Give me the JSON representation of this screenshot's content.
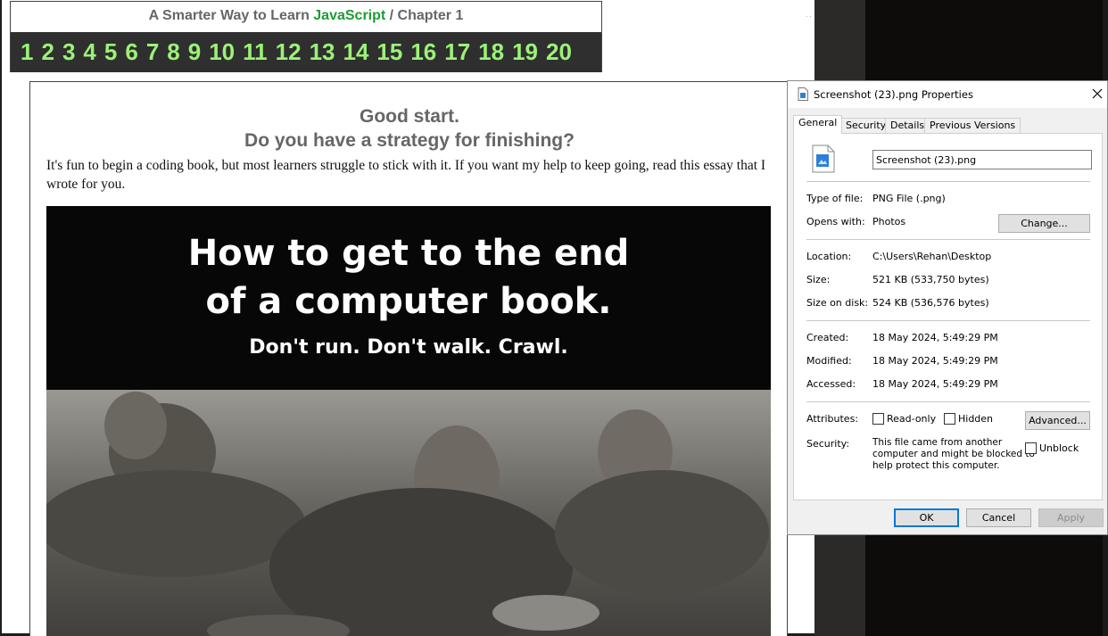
{
  "header": {
    "title_prefix": "A Smarter Way to Learn ",
    "title_brand": "JavaScript",
    "title_suffix": "  /  Chapter 1",
    "chapters": [
      "1",
      "2",
      "3",
      "4",
      "5",
      "6",
      "7",
      "8",
      "9",
      "10",
      "11",
      "12",
      "13",
      "14",
      "15",
      "16",
      "17",
      "18",
      "19",
      "20"
    ]
  },
  "page": {
    "dots": ". ."
  },
  "card": {
    "title_line1": "Good start.",
    "title_line2": "Do you have a strategy for finishing?",
    "body": "It's fun to begin a coding book, but most learners struggle to stick with it. If you want my help to keep going, read this essay that I wrote for you.",
    "banner_headline": "How to get to the end\nof a computer book.",
    "banner_subhead": "Don't run. Don't walk. Crawl."
  },
  "dialog": {
    "title": "Screenshot (23).png Properties",
    "tabs": [
      "General",
      "Security",
      "Details",
      "Previous Versions"
    ],
    "active_tab": "General",
    "file_name": "Screenshot (23).png",
    "type_label": "Type of file:",
    "type_value": "PNG File (.png)",
    "opens_label": "Opens with:",
    "opens_value": "Photos",
    "change_button": "Change...",
    "location_label": "Location:",
    "location_value": "C:\\Users\\Rehan\\Desktop",
    "size_label": "Size:",
    "size_value": "521 KB (533,750 bytes)",
    "size_disk_label": "Size on disk:",
    "size_disk_value": "524 KB (536,576 bytes)",
    "created_label": "Created:",
    "created_value": "18 May 2024, 5:49:29 PM",
    "modified_label": "Modified:",
    "modified_value": "18 May 2024, 5:49:29 PM",
    "accessed_label": "Accessed:",
    "accessed_value": "18 May 2024, 5:49:29 PM",
    "attributes_label": "Attributes:",
    "readonly_label": "Read-only",
    "hidden_label": "Hidden",
    "advanced_button": "Advanced...",
    "security_label": "Security:",
    "security_text": "This file came from another\ncomputer and might be blocked to\nhelp protect this computer.",
    "unblock_label": "Unblock",
    "ok_button": "OK",
    "cancel_button": "Cancel",
    "apply_button": "Apply"
  },
  "colors": {
    "brand_green": "#1f9a38",
    "chapter_green": "#9bf277",
    "focus_blue": "#0078d7"
  }
}
